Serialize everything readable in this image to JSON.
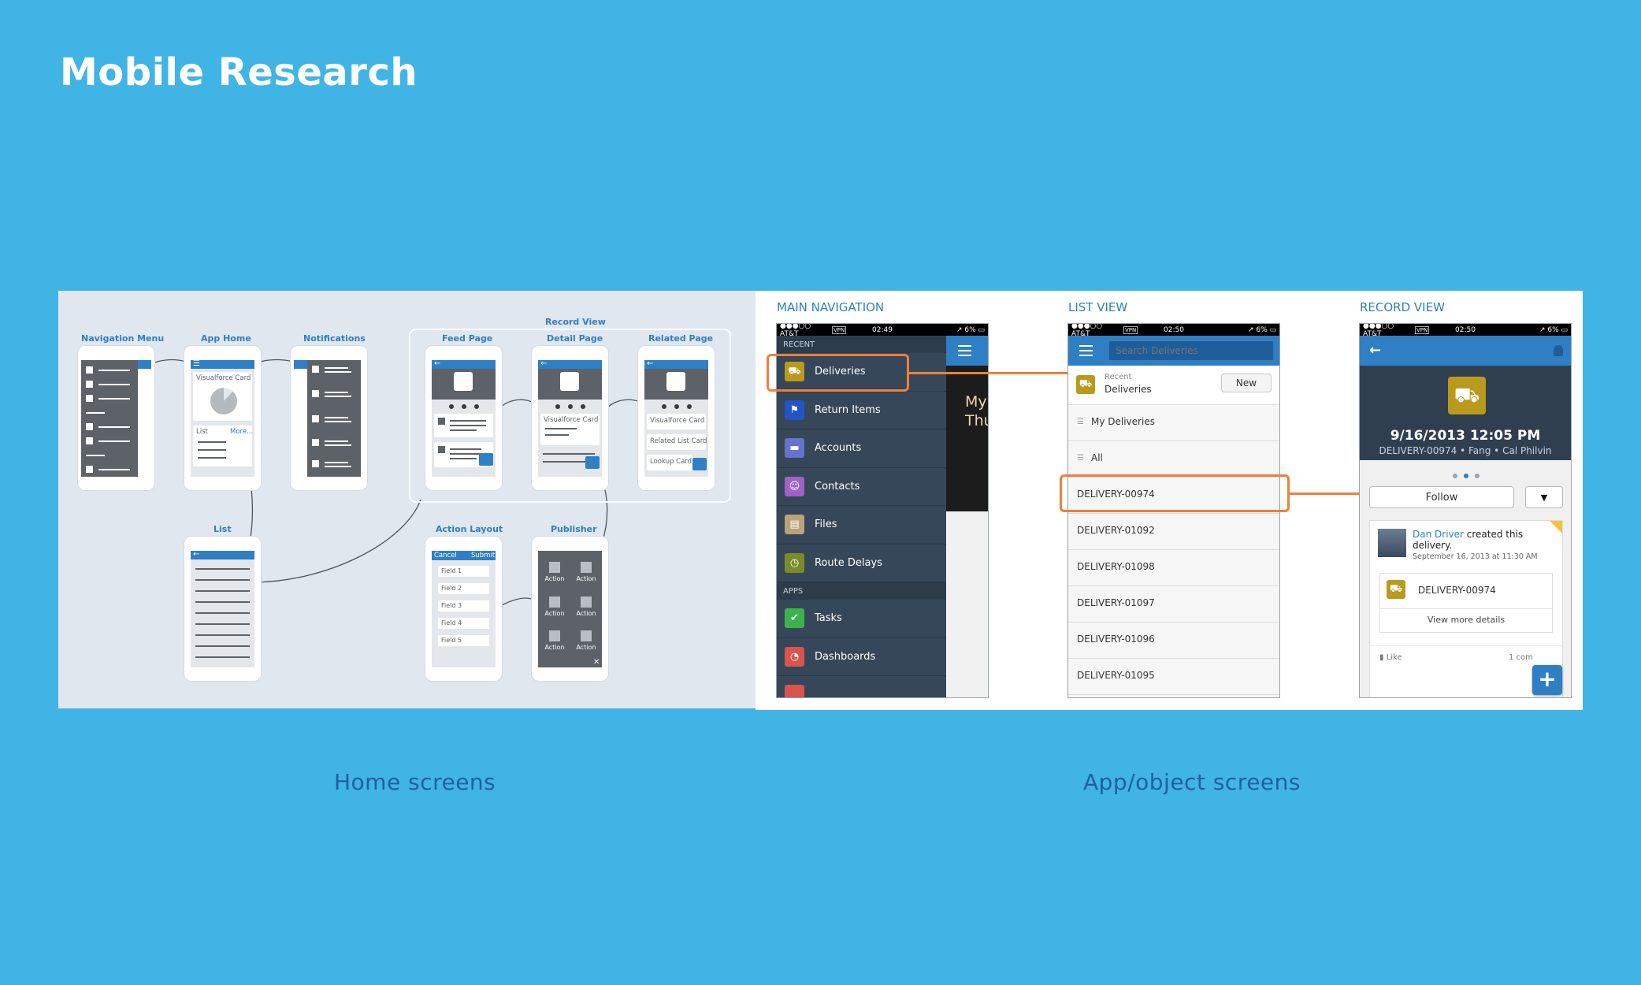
{
  "page_title": "Mobile Research",
  "captions": {
    "home": "Home screens",
    "app": "App/object screens"
  },
  "wireframes": {
    "labels": {
      "nav_menu": "Navigation Menu",
      "app_home": "App Home",
      "notifications": "Notifications",
      "record_view": "Record View",
      "feed_page": "Feed Page",
      "detail_page": "Detail Page",
      "related_page": "Related Page",
      "list": "List",
      "action_layout": "Action Layout",
      "publisher": "Publisher"
    },
    "app_home": {
      "card1": "Visualforce Card",
      "list": "List",
      "more": "More..."
    },
    "detail": {
      "card": "Visualforce Card"
    },
    "related": {
      "card1": "Visualforce Card",
      "card2": "Related List Card",
      "card3": "Lookup Card"
    },
    "action_layout": {
      "cancel": "Cancel",
      "submit": "Submit",
      "fields": [
        "Field 1",
        "Field 2",
        "Field 3",
        "Field 4",
        "Field 5"
      ]
    },
    "publisher": {
      "action": "Action",
      "close": "✕"
    }
  },
  "app_screens": {
    "labels": {
      "main_nav": "MAIN NAVIGATION",
      "list_view": "LIST VIEW",
      "record_view": "RECORD VIEW"
    },
    "status": {
      "carrier": "●●●○○ AT&T",
      "vpn": "VPN",
      "battery": "↗ 6% ▭",
      "time_nav": "02:49",
      "time_list": "02:50",
      "time_record": "02:50"
    },
    "nav": {
      "section_recent": "RECENT",
      "recent_items": [
        {
          "label": "Deliveries",
          "icon": "truck-icon",
          "color": "#b99a1d"
        },
        {
          "label": "Return Items",
          "icon": "flag-icon",
          "color": "#2254c5"
        },
        {
          "label": "Accounts",
          "icon": "folder-icon",
          "color": "#6672cc"
        },
        {
          "label": "Contacts",
          "icon": "contact-icon",
          "color": "#a062c9"
        },
        {
          "label": "Files",
          "icon": "file-icon",
          "color": "#b8a37a"
        },
        {
          "label": "Route Delays",
          "icon": "stopwatch-icon",
          "color": "#7a8c2a"
        }
      ],
      "section_apps": "APPS",
      "app_items": [
        {
          "label": "Tasks",
          "icon": "check-icon",
          "color": "#3cb34a"
        },
        {
          "label": "Dashboards",
          "icon": "gauge-icon",
          "color": "#d9534f"
        }
      ],
      "background_text": "My\nThu"
    },
    "list": {
      "search_placeholder": "Search Deliveries",
      "recent_small": "Recent",
      "recent_title": "Deliveries",
      "new_label": "New",
      "filters": [
        "My Deliveries",
        "All"
      ],
      "records": [
        "DELIVERY-00974",
        "DELIVERY-01092",
        "DELIVERY-01098",
        "DELIVERY-01097",
        "DELIVERY-01096",
        "DELIVERY-01095"
      ]
    },
    "record": {
      "title": "9/16/2013 12:05 PM",
      "subtitle": "DELIVERY-00974 • Fang • Cal Philvin",
      "follow": "Follow",
      "dropdown": "▼",
      "feed_author": "Dan Driver",
      "feed_action": " created this delivery.",
      "feed_time": "September 16, 2013 at 11:30 AM",
      "feed_record": "DELIVERY-00974",
      "view_more": "View more details",
      "like": "Like",
      "comments": "1 com",
      "fab": "+"
    },
    "accent": "#f07f3a"
  }
}
